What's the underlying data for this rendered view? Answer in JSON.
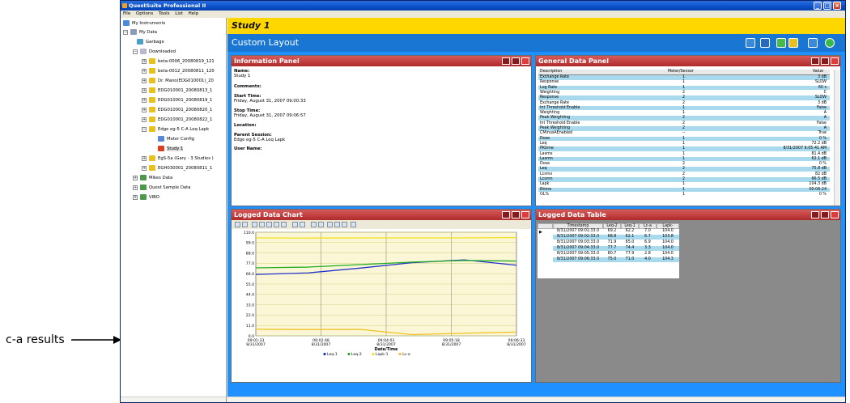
{
  "window": {
    "title": "QuestSuite Professional II",
    "menu": [
      "File",
      "Options",
      "Tools",
      "List",
      "Help"
    ]
  },
  "tree": {
    "items": [
      {
        "label": "My Instruments",
        "icon": "instruments-icon"
      },
      {
        "label": "My Data",
        "icon": "data-icon"
      },
      {
        "label": "Garbage",
        "icon": "garbage-icon"
      },
      {
        "label": "Downloaded",
        "icon": "folder-icon"
      },
      {
        "label": "beta-0006_20080819_121",
        "icon": "session-icon"
      },
      {
        "label": "beta-0012_20080811_120",
        "icon": "session-icon"
      },
      {
        "label": "Dr. Mano(EDG010001)_20",
        "icon": "session-icon"
      },
      {
        "label": "EDG010001_20080813_1",
        "icon": "session-icon"
      },
      {
        "label": "EDG010001_20080819_1",
        "icon": "session-icon"
      },
      {
        "label": "EDG010001_20080820_1",
        "icon": "session-icon"
      },
      {
        "label": "EDG010001_20080822_1",
        "icon": "session-icon"
      },
      {
        "label": "Edge eg-5 C-A Leq Lapk",
        "icon": "session-icon"
      },
      {
        "label": "Meter Config",
        "icon": "config-icon"
      },
      {
        "label": "Study 1",
        "icon": "study-icon"
      },
      {
        "label": "EgS-5a (Gary - 3 Studies )",
        "icon": "session-icon"
      },
      {
        "label": "EGH030001_20080811_1",
        "icon": "session-icon"
      },
      {
        "label": "Mikes Data",
        "icon": "group-icon"
      },
      {
        "label": "Quest Sample Data",
        "icon": "group-icon"
      },
      {
        "label": "VIBO",
        "icon": "group-icon"
      }
    ]
  },
  "main": {
    "study_title": "Study 1",
    "layout_title": "Custom Layout"
  },
  "info_panel": {
    "title": "Information Panel",
    "name_label": "Name:",
    "name_value": "Study 1",
    "comments_label": "Comments:",
    "start_label": "Start Time:",
    "start_value": "Friday, August 31, 2007 09:00:33",
    "stop_label": "Stop Time:",
    "stop_value": "Friday, August 31, 2007 09:06:57",
    "location_label": "Location:",
    "parent_label": "Parent Session:",
    "parent_value": "Edge eg-5 C-A Leq Lapk",
    "user_label": "User Name:"
  },
  "gdp": {
    "title": "General Data Panel",
    "headers": [
      "Description",
      "Meter/Sensor",
      "Value"
    ],
    "rows": [
      [
        "Exchange Rate",
        "1",
        "3 dB"
      ],
      [
        "Response",
        "1",
        "SLOW"
      ],
      [
        "Log Rate",
        "1",
        "60 s"
      ],
      [
        "Weighting",
        "2",
        "C"
      ],
      [
        "Response",
        "2",
        "SLOW"
      ],
      [
        "Exchange Rate",
        "2",
        "3 dB"
      ],
      [
        "Int Threshold Enable",
        "1",
        "False"
      ],
      [
        "Weighting",
        "1",
        "A"
      ],
      [
        "Peak Weighting",
        "2",
        "A"
      ],
      [
        "Int Threshold Enable",
        "2",
        "False"
      ],
      [
        "Peak Weighting",
        "2",
        "A"
      ],
      [
        "CMinusAEnabled",
        "--",
        "True"
      ],
      [
        "Dose",
        "1",
        "0 %"
      ],
      [
        "Leq",
        "1",
        "72.2 dB"
      ],
      [
        "PKtime",
        "1",
        "8/31/2007 9:05:41 AM"
      ],
      [
        "Lasmx",
        "1",
        "81.4 dB"
      ],
      [
        "Lasmn",
        "1",
        "62.1 dB"
      ],
      [
        "Dose",
        "2",
        "0 %"
      ],
      [
        "Leq",
        "2",
        "75.8 dB"
      ],
      [
        "Lcsmx",
        "2",
        "82 dB"
      ],
      [
        "Lcsmn",
        "2",
        "66.5 dB"
      ],
      [
        "Lapk",
        "1",
        "104.3 dB"
      ],
      [
        "Rtime",
        "1",
        "00:06:24"
      ],
      [
        "OL%",
        "1",
        "0 %"
      ]
    ]
  },
  "chart_panel": {
    "title": "Logged Data Chart"
  },
  "chart_data": {
    "type": "line",
    "xlabel": "Date/Time",
    "x": [
      "09:01:33 8/31/2007",
      "09:02:33 8/31/2007",
      "09:03:33 8/31/2007",
      "09:04:33 8/31/2007",
      "09:05:33 8/31/2007",
      "09:06:33 8/31/2007"
    ],
    "x_ticks": [
      {
        "time": "09:01:33",
        "date": "8/31/2007"
      },
      {
        "time": "09:02:48",
        "date": "8/31/2007"
      },
      {
        "time": "09:04:03",
        "date": "8/31/2007"
      },
      {
        "time": "09:05:18",
        "date": "8/31/2007"
      },
      {
        "time": "09:06:33",
        "date": "8/31/2007"
      }
    ],
    "y_ticks": [
      "0.0",
      "11.0",
      "22.0",
      "33.0",
      "44.0",
      "55.0",
      "66.0",
      "77.0",
      "88.0",
      "99.0",
      "110.0"
    ],
    "ylim": [
      0,
      110
    ],
    "series": [
      {
        "name": "Leq-1",
        "color": "#2233cc",
        "values": [
          65.2,
          66.8,
          71.9,
          77.7,
          80.7,
          75.0
        ]
      },
      {
        "name": "Leq-2",
        "color": "#22aa22",
        "values": [
          72.2,
          73.0,
          75.6,
          78.3,
          80.0,
          79.4
        ]
      },
      {
        "name": "Lapk-1",
        "color": "#f0e020",
        "values": [
          104.0,
          103.8,
          104.0,
          104.0,
          104.0,
          104.3
        ]
      },
      {
        "name": "Lc-a",
        "color": "#f0c020",
        "values": [
          7.0,
          6.7,
          6.9,
          1.3,
          2.8,
          4.0
        ]
      }
    ],
    "grid": true,
    "legend": "bottom"
  },
  "ldt": {
    "title": "Logged Data Table",
    "headers": [
      "Timestamp",
      "Leq-2",
      "Leq-1",
      "Lc-a",
      "Lapk-"
    ],
    "rows": [
      [
        "8/31/2007 09:01:33.0",
        "69.2",
        "62.2",
        "7.0",
        "104.0"
      ],
      [
        "8/31/2007 09:02:33.0",
        "68.8",
        "62.1",
        "6.7",
        "103.8"
      ],
      [
        "8/31/2007 09:03:33.0",
        "71.9",
        "65.0",
        "6.9",
        "104.0"
      ],
      [
        "8/31/2007 09:04:33.0",
        "77.7",
        "74.4",
        "3.3",
        "104.0"
      ],
      [
        "8/31/2007 09:05:33.0",
        "80.7",
        "77.9",
        "2.8",
        "104.0"
      ],
      [
        "8/31/2007 09:06:33.0",
        "75.0",
        "71.0",
        "4.0",
        "104.3"
      ]
    ]
  },
  "annotation": {
    "text": "c-a results"
  }
}
